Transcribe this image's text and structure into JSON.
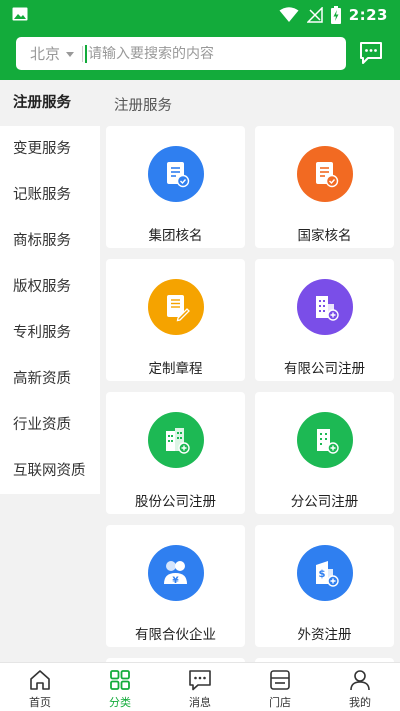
{
  "status_bar": {
    "time": "2:23"
  },
  "header": {
    "city": "北京",
    "search_placeholder": "请输入要搜索的内容"
  },
  "sidebar": {
    "items": [
      {
        "label": "注册服务",
        "active": true
      },
      {
        "label": "变更服务"
      },
      {
        "label": "记账服务"
      },
      {
        "label": "商标服务"
      },
      {
        "label": "版权服务"
      },
      {
        "label": "专利服务"
      },
      {
        "label": "高新资质"
      },
      {
        "label": "行业资质"
      },
      {
        "label": "互联网资质"
      }
    ]
  },
  "content": {
    "section_title": "注册服务",
    "cards": [
      {
        "label": "集团核名",
        "icon": "document-check-icon",
        "color": "#2f7ff0"
      },
      {
        "label": "国家核名",
        "icon": "document-check-icon",
        "color": "#f26a22"
      },
      {
        "label": "定制章程",
        "icon": "document-edit-icon",
        "color": "#f5a300"
      },
      {
        "label": "有限公司注册",
        "icon": "building-add-icon",
        "color": "#7a4ee8"
      },
      {
        "label": "股份公司注册",
        "icon": "buildings-add-icon",
        "color": "#1db954"
      },
      {
        "label": "分公司注册",
        "icon": "building-add-icon",
        "color": "#1db954"
      },
      {
        "label": "有限合伙企业",
        "icon": "partners-yen-icon",
        "color": "#2f7ff0"
      },
      {
        "label": "外资注册",
        "icon": "building-dollar-icon",
        "color": "#2f7ff0"
      }
    ]
  },
  "bottom_nav": {
    "items": [
      {
        "label": "首页",
        "icon": "home-icon"
      },
      {
        "label": "分类",
        "icon": "category-icon",
        "active": true
      },
      {
        "label": "消息",
        "icon": "message-icon"
      },
      {
        "label": "门店",
        "icon": "store-icon"
      },
      {
        "label": "我的",
        "icon": "person-icon"
      }
    ]
  },
  "colors": {
    "brand": "#13ab3b"
  }
}
